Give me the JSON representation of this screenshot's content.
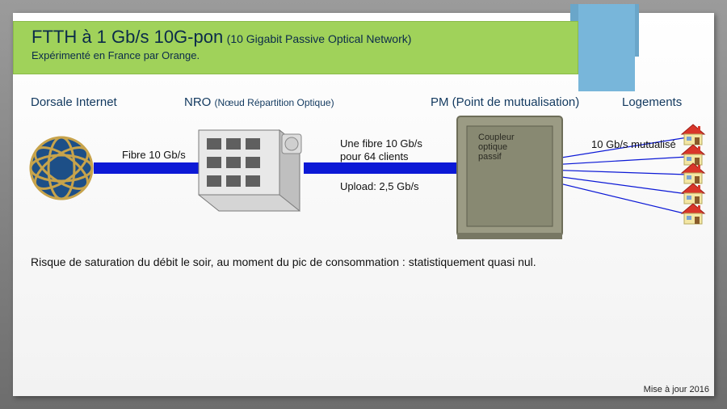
{
  "title": {
    "main": "FTTH à 1 Gb/s 10G-pon",
    "paren": "(10 Gigabit Passive Optical Network)",
    "note": "Expérimenté en France par Orange."
  },
  "columns": {
    "backbone": "Dorsale Internet",
    "nro": "NRO",
    "nro_paren": "(Nœud Répartition Optique)",
    "pm": "PM (Point de mutualisation)",
    "homes": "Logements"
  },
  "labels": {
    "fiber10": "Fibre 10 Gb/s",
    "fiber_per64_a": "Une fibre 10 Gb/s",
    "fiber_per64_b": "pour 64 clients",
    "upload": "Upload: 2,5 Gb/s",
    "shared": "10 Gb/s mutualisé",
    "coupler_a": "Coupleur",
    "coupler_b": "optique",
    "coupler_c": "passif"
  },
  "risk": "Risque de saturation du débit le soir, au moment du pic de consommation : statistiquement quasi nul.",
  "footer": "Mise à jour 2016",
  "chart_data": {
    "type": "network-diagram",
    "nodes": [
      {
        "id": "backbone",
        "label": "Dorsale Internet",
        "kind": "internet-globe"
      },
      {
        "id": "nro",
        "label": "NRO (Nœud Répartition Optique)",
        "kind": "building"
      },
      {
        "id": "pm",
        "label": "PM (Point de mutualisation)",
        "kind": "cabinet",
        "annotation": "Coupleur optique passif"
      },
      {
        "id": "homes",
        "label": "Logements",
        "kind": "houses",
        "count": 5
      }
    ],
    "links": [
      {
        "from": "backbone",
        "to": "nro",
        "label": "Fibre 10 Gb/s",
        "bandwidth_gbps": 10
      },
      {
        "from": "nro",
        "to": "pm",
        "label": "Une fibre 10 Gb/s pour 64 clients",
        "bandwidth_gbps": 10,
        "upload_gbps": 2.5,
        "clients_per_fiber": 64
      },
      {
        "from": "pm",
        "to": "homes",
        "label": "10 Gb/s mutualisé",
        "bandwidth_gbps": 10,
        "shared": true,
        "fanout": 5
      }
    ],
    "note": "Risque de saturation du débit le soir, au moment du pic de consommation : statistiquement quasi nul."
  }
}
